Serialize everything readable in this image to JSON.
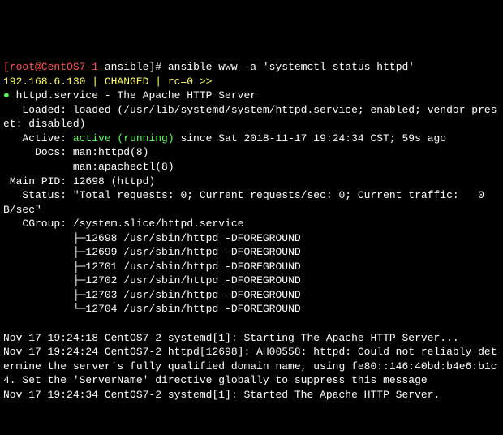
{
  "prompt": {
    "user_host": "[root@CentOS7-1",
    "cwd": " ansible]",
    "hash": "# ",
    "command": "ansible www -a 'systemctl status httpd'"
  },
  "ansible": {
    "header": "192.168.6.130 | CHANGED | rc=0 >>"
  },
  "service": {
    "dot": "●",
    "title": " httpd.service - The Apache HTTP Server",
    "loaded": "   Loaded: loaded (/usr/lib/systemd/system/httpd.service; enabled; vendor preset: disabled)",
    "active_label": "   Active: ",
    "active_value": "active (running)",
    "active_since": " since Sat 2018-11-17 19:24:34 CST; 59s ago",
    "docs1": "     Docs: man:httpd(8)",
    "docs2": "           man:apachectl(8)",
    "main_pid": " Main PID: 12698 (httpd)",
    "status_line": "   Status: \"Total requests: 0; Current requests/sec: 0; Current traffic:   0 B/sec\"",
    "cgroup": "   CGroup: /system.slice/httpd.service",
    "proc1": "           ├─12698 /usr/sbin/httpd -DFOREGROUND",
    "proc2": "           ├─12699 /usr/sbin/httpd -DFOREGROUND",
    "proc3": "           ├─12701 /usr/sbin/httpd -DFOREGROUND",
    "proc4": "           ├─12702 /usr/sbin/httpd -DFOREGROUND",
    "proc5": "           ├─12703 /usr/sbin/httpd -DFOREGROUND",
    "proc6": "           └─12704 /usr/sbin/httpd -DFOREGROUND"
  },
  "logs": {
    "l1": "Nov 17 19:24:18 CentOS7-2 systemd[1]: Starting The Apache HTTP Server...",
    "l2": "Nov 17 19:24:24 CentOS7-2 httpd[12698]: AH00558: httpd: Could not reliably determine the server's fully qualified domain name, using fe80::146:40bd:b4e6:b1c4. Set the 'ServerName' directive globally to suppress this message",
    "l3": "Nov 17 19:24:34 CentOS7-2 systemd[1]: Started The Apache HTTP Server."
  }
}
